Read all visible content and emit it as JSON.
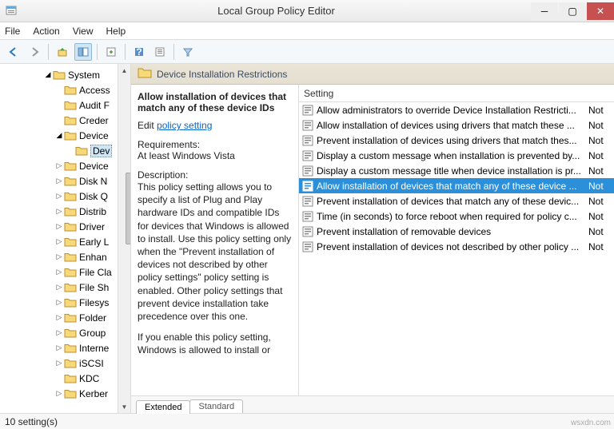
{
  "title": "Local Group Policy Editor",
  "menu": [
    "File",
    "Action",
    "View",
    "Help"
  ],
  "tree": {
    "root": "System",
    "items": [
      {
        "l": "Access",
        "a": "",
        "d": 0
      },
      {
        "l": "Audit F",
        "a": "",
        "d": 0
      },
      {
        "l": "Creder",
        "a": "",
        "d": 0
      },
      {
        "l": "Device",
        "a": "open",
        "d": 0
      },
      {
        "l": "Dev",
        "a": "",
        "d": 1,
        "sel": true
      },
      {
        "l": "Device",
        "a": "closed",
        "d": 0
      },
      {
        "l": "Disk N",
        "a": "closed",
        "d": 0
      },
      {
        "l": "Disk Q",
        "a": "closed",
        "d": 0
      },
      {
        "l": "Distrib",
        "a": "closed",
        "d": 0
      },
      {
        "l": "Driver",
        "a": "closed",
        "d": 0
      },
      {
        "l": "Early L",
        "a": "closed",
        "d": 0
      },
      {
        "l": "Enhan",
        "a": "closed",
        "d": 0
      },
      {
        "l": "File Cla",
        "a": "closed",
        "d": 0
      },
      {
        "l": "File Sh",
        "a": "closed",
        "d": 0
      },
      {
        "l": "Filesys",
        "a": "closed",
        "d": 0
      },
      {
        "l": "Folder",
        "a": "closed",
        "d": 0
      },
      {
        "l": "Group",
        "a": "closed",
        "d": 0
      },
      {
        "l": "Interne",
        "a": "closed",
        "d": 0
      },
      {
        "l": "iSCSI",
        "a": "closed",
        "d": 0
      },
      {
        "l": "KDC",
        "a": "",
        "d": 0
      },
      {
        "l": "Kerber",
        "a": "closed",
        "d": 0
      }
    ]
  },
  "header": "Device Installation Restrictions",
  "info": {
    "title": "Allow installation of devices that match any of these device IDs",
    "edit_pre": "Edit ",
    "edit_link": "policy setting ",
    "req_label": "Requirements:",
    "req_text": "At least Windows Vista",
    "desc_label": "Description:",
    "desc_text": "This policy setting allows you to specify a list of Plug and Play hardware IDs and compatible IDs for devices that Windows is allowed to install. Use this policy setting only when the \"Prevent installation of devices not described by other policy settings\" policy setting is enabled. Other policy settings that prevent device installation take precedence over this one.",
    "desc_text2": "If you enable this policy setting, Windows is allowed to install or"
  },
  "list": {
    "header": "Setting",
    "stcol": "Not",
    "rows": [
      {
        "t": "Allow administrators to override Device Installation Restricti...",
        "s": "Not"
      },
      {
        "t": "Allow installation of devices using drivers that match these ...",
        "s": "Not"
      },
      {
        "t": "Prevent installation of devices using drivers that match thes...",
        "s": "Not"
      },
      {
        "t": "Display a custom message when installation is prevented by...",
        "s": "Not"
      },
      {
        "t": "Display a custom message title when device installation is pr...",
        "s": "Not"
      },
      {
        "t": "Allow installation of devices that match any of these device ...",
        "s": "Not",
        "sel": true
      },
      {
        "t": "Prevent installation of devices that match any of these devic...",
        "s": "Not"
      },
      {
        "t": "Time (in seconds) to force reboot when required for policy c...",
        "s": "Not"
      },
      {
        "t": "Prevent installation of removable devices",
        "s": "Not"
      },
      {
        "t": "Prevent installation of devices not described by other policy ...",
        "s": "Not"
      }
    ]
  },
  "tabs": {
    "extended": "Extended",
    "standard": "Standard"
  },
  "status": "10 setting(s)",
  "watermark": "wsxdn.com"
}
